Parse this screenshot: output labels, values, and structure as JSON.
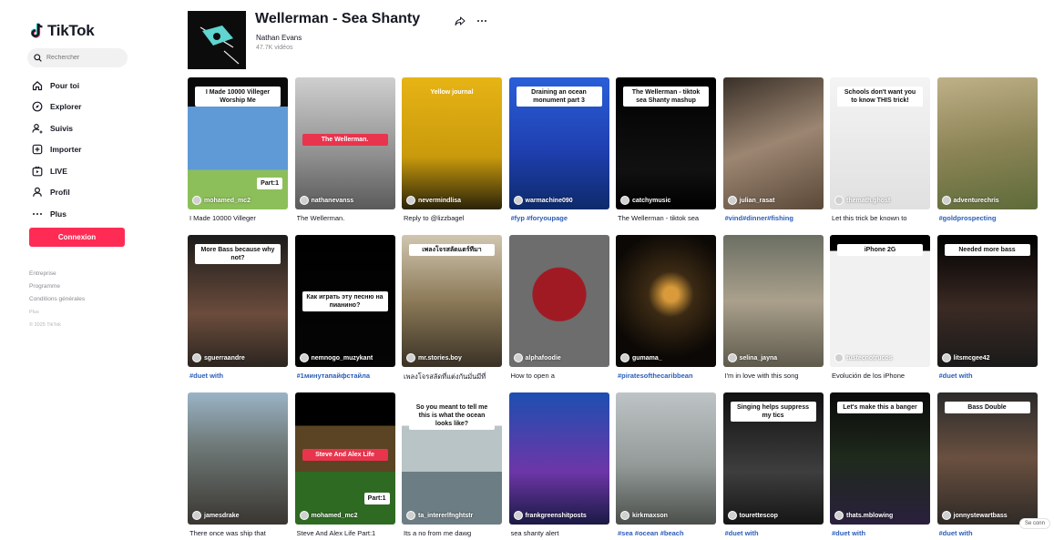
{
  "sidebar": {
    "brand": "TikTok",
    "search_placeholder": "Rechercher",
    "nav": [
      {
        "label": "Pour toi",
        "icon": "home-icon"
      },
      {
        "label": "Explorer",
        "icon": "compass-icon"
      },
      {
        "label": "Suivis",
        "icon": "users-icon"
      },
      {
        "label": "Importer",
        "icon": "upload-icon"
      },
      {
        "label": "LIVE",
        "icon": "live-icon"
      },
      {
        "label": "Profil",
        "icon": "profile-icon"
      },
      {
        "label": "Plus",
        "icon": "more-icon"
      }
    ],
    "login_label": "Connexion",
    "footer": [
      "Entreprise",
      "Programme",
      "Conditions générales",
      "Plus",
      "© 2025 TikTok"
    ]
  },
  "sound": {
    "title": "Wellerman - Sea Shanty",
    "artist": "Nathan Evans",
    "videos": "47.7K vidéos"
  },
  "colors": {
    "brand_red": "#fe2c55",
    "hashtag_blue": "#2b5db9"
  },
  "videos": [
    {
      "user": "mohamed_mc2",
      "caption": "I Made 10000 Villeger",
      "tag": false,
      "overlay": "I Made 10000 Villeger Worship Me",
      "bg": "linear-gradient(180deg,#0a0a0a 0 22%,#5f9ad6 22% 70%,#8cbf5a 70% 100%)",
      "extra": "Part:1"
    },
    {
      "user": "nathanevanss",
      "caption": "The Wellerman.",
      "tag": false,
      "overlay": "The Wellerman.",
      "bg": "linear-gradient(180deg,#cfcfcf,#8e8e8e 60%,#5a5a5a)"
    },
    {
      "user": "nevermindlisa",
      "caption": "Reply to @lizzbagel",
      "tag": false,
      "overlay": "Yellow journal",
      "bg": "linear-gradient(180deg,#e7b415,#c99a0c 60%,#2a2309)"
    },
    {
      "user": "warmachine090",
      "caption": "#fyp #foryoupage",
      "tag": true,
      "overlay": "Draining an ocean monument part 3",
      "bg": "linear-gradient(180deg,#2a5fd8,#1f3fb0 55%,#0e2a6b)"
    },
    {
      "user": "catchymusic",
      "caption": "The Wellerman - tiktok sea",
      "tag": false,
      "overlay": "The Wellerman - tiktok sea Shanty mashup",
      "bg": "linear-gradient(180deg,#000,#111 70%,#000)"
    },
    {
      "user": "julian_rasat",
      "caption": "#vind#dinner#fishing",
      "tag": true,
      "overlay": "",
      "bg": "linear-gradient(160deg,#3a3028,#9c8672 50%,#5a4838)"
    },
    {
      "user": "themath.ghost",
      "caption": "Let this trick be known to",
      "tag": false,
      "overlay": "Schools don't want you to know THIS trick!",
      "bg": "linear-gradient(180deg,#f4f4f4,#e0e0e0)"
    },
    {
      "user": "adventurechris",
      "caption": "#goldprospecting",
      "tag": true,
      "overlay": "",
      "bg": "linear-gradient(170deg,#bfb088,#8d8557 50%,#5e6b3a)"
    },
    {
      "user": "sguerraandre",
      "caption": "#duet with",
      "tag": true,
      "overlay": "More Bass because why not?",
      "bg": "linear-gradient(180deg,#1b1b1b,#6b4c3c 60%,#2b2520)"
    },
    {
      "user": "nemnogo_muzykant",
      "caption": "#1минутапайфстайла",
      "tag": true,
      "overlay": "Как играть эту песню на пианино?",
      "bg": "linear-gradient(180deg,#000,#050505)"
    },
    {
      "user": "mr.stories.boy",
      "caption": "เพลงโจรสลัดที่แต่งกันมั่นมีที่",
      "tag": false,
      "overlay": "เพลงโจรสลัดแตร์ทีมา",
      "bg": "linear-gradient(180deg,#d0c6b0,#8c7a58 50%,#3a3226)"
    },
    {
      "user": "alphafoodie",
      "caption": "How to open a",
      "tag": false,
      "overlay": "",
      "bg": "radial-gradient(circle at 50% 45%,#a01a24 0 30%,#6d6d6d 31% 100%)"
    },
    {
      "user": "gumama_",
      "caption": "#piratesofthecaribbean",
      "tag": true,
      "overlay": "",
      "bg": "radial-gradient(circle at 55% 45%,#d89a3a 0 8%,#3b2a14 25%,#0b0805 70%)"
    },
    {
      "user": "selina_jayna",
      "caption": "I'm in love with this song",
      "tag": false,
      "overlay": "",
      "bg": "linear-gradient(180deg,#6b6f63,#aaa08c 50%,#5e5a4c)"
    },
    {
      "user": "tustecnotrucos",
      "caption": "Evolución de los iPhone",
      "tag": false,
      "overlay": "iPhone 2G",
      "bg": "linear-gradient(180deg,#000 0 12%,#f1f1f1 12% 100%)"
    },
    {
      "user": "litsmcgee42",
      "caption": "#duet with",
      "tag": true,
      "overlay": "Needed more bass",
      "bg": "linear-gradient(180deg,#000,#3b2a24 55%,#1a1a1a)"
    },
    {
      "user": "jamesdrake",
      "caption": "There once was ship that",
      "tag": false,
      "overlay": "",
      "bg": "linear-gradient(180deg,#9ab4c6,#6f7a78 40%,#3a3530)"
    },
    {
      "user": "mohamed_mc2",
      "caption": "Steve And Alex Life Part:1",
      "tag": false,
      "overlay": "Steve And Alex Life",
      "bg": "linear-gradient(180deg,#000 0 25%,#5a4424 25% 60%,#2f6a23 60% 100%)",
      "extra": "Part:1"
    },
    {
      "user": "ta_intererlfnghtstr",
      "caption": "Its a no from me dawg",
      "tag": false,
      "overlay": "So you meant to tell me this is what the ocean looks like?",
      "bg": "linear-gradient(180deg,#fff 0 25%,#b9c4c6 25% 60%,#6c7d84 60% 100%)"
    },
    {
      "user": "frankgreenshitposts",
      "caption": "sea shanty alert",
      "tag": false,
      "overlay": "",
      "bg": "linear-gradient(180deg,#1d4fb0,#6d36a8 60%,#1a1a44)"
    },
    {
      "user": "kirkmaxson",
      "caption": "#sea #ocean #beach",
      "tag": true,
      "overlay": "",
      "bg": "linear-gradient(180deg,#bec4c6,#939a98 55%,#4b4f4b)"
    },
    {
      "user": "tourettescop",
      "caption": "#duet with",
      "tag": true,
      "overlay": "Singing helps suppress my tics",
      "bg": "linear-gradient(180deg,#111,#3e3e3e 60%,#151515)"
    },
    {
      "user": "thats.mblowing",
      "caption": "#duet with",
      "tag": true,
      "overlay": "Let's make this a banger",
      "bg": "linear-gradient(180deg,#0a0a0a,#1f2a1c 50%,#2a1f3d)"
    },
    {
      "user": "jonnystewartbass",
      "caption": "#duet with",
      "tag": true,
      "overlay": "Bass Double",
      "bg": "linear-gradient(180deg,#2b2b2b,#6a5040 50%,#2f2a26)"
    }
  ],
  "scroll_hint": "Se conn"
}
